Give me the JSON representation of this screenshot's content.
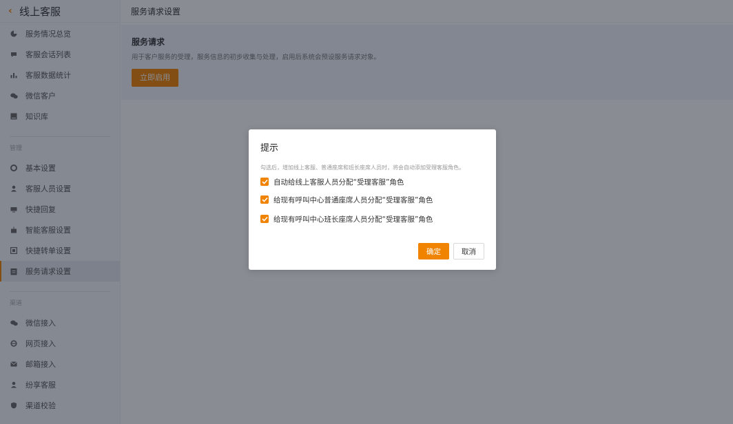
{
  "sidebar": {
    "title": "线上客服",
    "items_top": [
      {
        "label": "服务情况总览",
        "icon": "pie-chart-icon"
      },
      {
        "label": "客服会话列表",
        "icon": "chat-bubble-icon"
      },
      {
        "label": "客服数据统计",
        "icon": "bar-chart-icon"
      },
      {
        "label": "微信客户",
        "icon": "wechat-icon"
      },
      {
        "label": "知识库",
        "icon": "book-icon"
      }
    ],
    "section_manage": "管理",
    "items_manage": [
      {
        "label": "基本设置",
        "icon": "gear-icon"
      },
      {
        "label": "客服人员设置",
        "icon": "person-icon"
      },
      {
        "label": "快捷回复",
        "icon": "message-icon"
      },
      {
        "label": "智能客服设置",
        "icon": "robot-icon"
      },
      {
        "label": "快捷转单设置",
        "icon": "ticket-icon"
      },
      {
        "label": "服务请求设置",
        "icon": "clipboard-icon"
      }
    ],
    "section_channel": "渠道",
    "items_channel": [
      {
        "label": "微信接入",
        "icon": "wechat-icon"
      },
      {
        "label": "网页接入",
        "icon": "browser-icon"
      },
      {
        "label": "邮箱接入",
        "icon": "mail-icon"
      },
      {
        "label": "纷享客服",
        "icon": "person-icon"
      },
      {
        "label": "渠道校验",
        "icon": "shield-icon"
      }
    ],
    "active_item": "服务请求设置"
  },
  "main": {
    "page_title": "服务请求设置",
    "card_title": "服务请求",
    "card_desc": "用于客户服务的受理，服务信息的初步收集与处理，启用后系统会预设服务请求对象。",
    "enable_button": "立即启用"
  },
  "modal": {
    "title": "提示",
    "description": "勾选后，增加线上客服、普通座席和班长座席人员时，将会自动添加受理客服角色。",
    "options": [
      {
        "label": "自动给线上客服人员分配“受理客服”角色",
        "checked": true
      },
      {
        "label": "给现有呼叫中心普通座席人员分配“受理客服”角色",
        "checked": true
      },
      {
        "label": "给现有呼叫中心班长座席人员分配“受理客服”角色",
        "checked": true
      }
    ],
    "ok_label": "确定",
    "cancel_label": "取消"
  },
  "colors": {
    "accent": "#f08300",
    "mask": "#141a28",
    "sidebar_bg": "#f7f8fa",
    "card_bg": "#f2f5fa"
  }
}
